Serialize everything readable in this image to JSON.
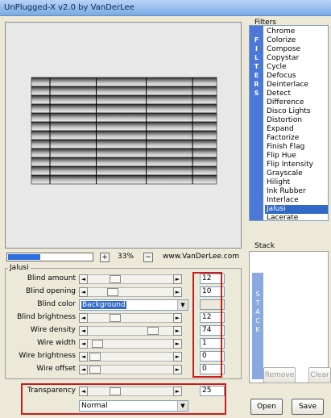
{
  "window": {
    "title": "UnPlugged-X v2.0 by VanDerLee"
  },
  "preview": {
    "zoom_percent": 33,
    "zoom_label": "33%",
    "zoom_plus": "+",
    "zoom_minus": "−",
    "site": "www.VanDerLee.com",
    "progress_fraction": 0.38
  },
  "filters": {
    "group_label": "Filters",
    "strip_text": [
      "F",
      "I",
      "L",
      "T",
      "E",
      "R",
      "S"
    ],
    "items": [
      "Chrome",
      "Colorize",
      "Compose",
      "Copystar",
      "Cycle",
      "Defocus",
      "Deinterlace",
      "Detect",
      "Difference",
      "Disco Lights",
      "Distortion",
      "Expand",
      "Factorize",
      "Finish Flag",
      "Flip Hue",
      "Flip Intensity",
      "Grayscale",
      "Hilight",
      "Ink Rubber",
      "Interlace",
      "Jalusi",
      "Lacerate"
    ],
    "selected": "Jalusi"
  },
  "stack": {
    "group_label": "Stack",
    "strip_text": [
      "S",
      "T",
      "A",
      "C",
      "K"
    ],
    "remove_label": "Remove",
    "clear_label": "Clear"
  },
  "params": {
    "group_label": "Jalusi",
    "rows": [
      {
        "label": "Blind amount",
        "value": "12",
        "thumb": 0.25
      },
      {
        "label": "Blind opening",
        "value": "10",
        "thumb": 0.22
      },
      {
        "label": "Blind brightness",
        "value": "12",
        "thumb": 0.25
      },
      {
        "label": "Wire density",
        "value": "74",
        "thumb": 0.72
      },
      {
        "label": "Wire width",
        "value": "1",
        "thumb": 0.03
      },
      {
        "label": "Wire brightness",
        "value": "0",
        "thumb": 0.0
      },
      {
        "label": "Wire offset",
        "value": "0",
        "thumb": 0.0
      }
    ],
    "blind_color_label": "Blind color",
    "blind_color_value": "Background"
  },
  "transparency": {
    "label": "Transparency",
    "value": "25",
    "thumb": 0.25,
    "mode": "Normal"
  },
  "buttons": {
    "open_label": "Open",
    "save_label": "Save"
  },
  "arrows": {
    "left": "◄",
    "right": "►",
    "down": "▼"
  },
  "colors": {
    "accent": "#3169c6",
    "highlight_box": "#cc1b1b"
  }
}
